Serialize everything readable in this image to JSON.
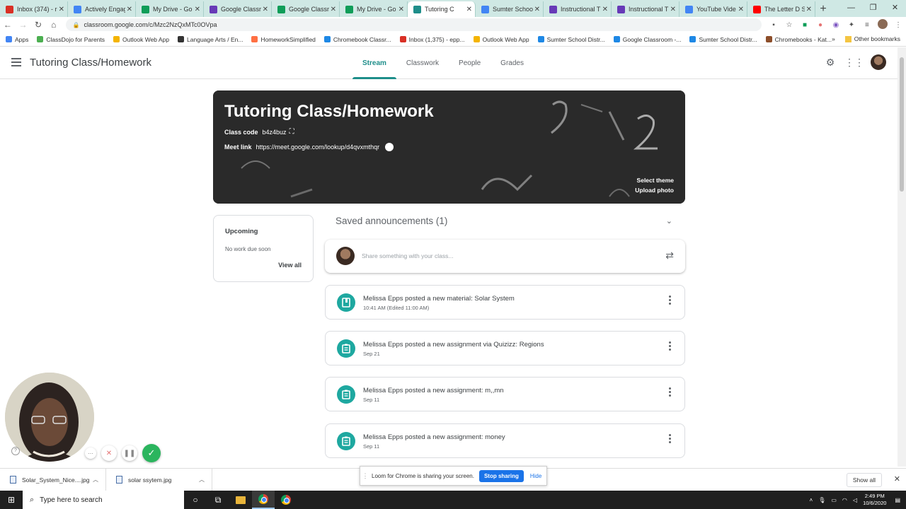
{
  "browser": {
    "tabs": [
      {
        "title": "Inbox (374) - r",
        "color": "#d93025",
        "active": false
      },
      {
        "title": "Actively Engag",
        "color": "#4285f4",
        "active": false
      },
      {
        "title": "My Drive - Go",
        "color": "#0f9d58",
        "active": false
      },
      {
        "title": "Google Classr",
        "color": "#673ab7",
        "active": false
      },
      {
        "title": "Google Classr",
        "color": "#0f9d58",
        "active": false
      },
      {
        "title": "My Drive - Go",
        "color": "#0f9d58",
        "active": false
      },
      {
        "title": "Tutoring C",
        "color": "#1e8e8a",
        "active": true
      },
      {
        "title": "Sumter Schoo",
        "color": "#4285f4",
        "active": false
      },
      {
        "title": "Instructional T",
        "color": "#673ab7",
        "active": false
      },
      {
        "title": "Instructional T",
        "color": "#673ab7",
        "active": false
      },
      {
        "title": "YouTube Vide",
        "color": "#4285f4",
        "active": false
      },
      {
        "title": "The Letter D S",
        "color": "#ff0000",
        "active": false
      }
    ],
    "url": "classroom.google.com/c/Mzc2NzQxMTc0OVpa",
    "bookmarks": [
      {
        "label": "Apps",
        "color": "#4285f4"
      },
      {
        "label": "ClassDojo for Parents",
        "color": "#4caf50"
      },
      {
        "label": "Outlook Web App",
        "color": "#f4b400"
      },
      {
        "label": "Language Arts / En...",
        "color": "#333333"
      },
      {
        "label": "HomeworkSimplified",
        "color": "#ff7043"
      },
      {
        "label": "Chromebook Classr...",
        "color": "#1e88e5"
      },
      {
        "label": "Inbox (1,375) - epp...",
        "color": "#d93025"
      },
      {
        "label": "Outlook Web App",
        "color": "#f4b400"
      },
      {
        "label": "Sumter School Distr...",
        "color": "#1e88e5"
      },
      {
        "label": "Google Classroom -...",
        "color": "#1e88e5"
      },
      {
        "label": "Sumter School Distr...",
        "color": "#1e88e5"
      },
      {
        "label": "Chromebooks - Kat...",
        "color": "#8d4e2a"
      }
    ],
    "other_bookmarks": "Other bookmarks"
  },
  "classroom": {
    "class_name": "Tutoring Class/Homework",
    "tabs": [
      "Stream",
      "Classwork",
      "People",
      "Grades"
    ],
    "accent": "#1e8e8a"
  },
  "banner": {
    "title": "Tutoring Class/Homework",
    "class_code_label": "Class code",
    "class_code": "b4z4buz",
    "meet_label": "Meet link",
    "meet_url": "https://meet.google.com/lookup/d4qvxmthqr",
    "select_theme": "Select theme",
    "upload_photo": "Upload photo"
  },
  "upcoming": {
    "heading": "Upcoming",
    "status": "No work due soon",
    "view_all": "View all"
  },
  "saved": {
    "label": "Saved announcements (1)"
  },
  "share": {
    "placeholder": "Share something with your class..."
  },
  "posts": [
    {
      "title": "Melissa Epps posted a new material: Solar System",
      "date": "10:41 AM (Edited 11:00 AM)",
      "icon": "material-icon"
    },
    {
      "title": "Melissa Epps posted a new assignment via Quizizz: Regions",
      "date": "Sep 21",
      "icon": "assignment-icon"
    },
    {
      "title": "Melissa Epps posted a new assignment: m,,mn",
      "date": "Sep 11",
      "icon": "assignment-icon"
    },
    {
      "title": "Melissa Epps posted a new assignment: money",
      "date": "Sep 11",
      "icon": "assignment-icon"
    }
  ],
  "downloads": [
    {
      "name": "Solar_System_Nice....jpg"
    },
    {
      "name": "solar ssytem.jpg"
    }
  ],
  "show_all": "Show all",
  "loom": {
    "message": "Loom for Chrome is sharing your screen.",
    "stop": "Stop sharing",
    "hide": "Hide"
  },
  "taskbar": {
    "search_placeholder": "Type here to search",
    "time": "2:49 PM",
    "date": "10/6/2020"
  }
}
